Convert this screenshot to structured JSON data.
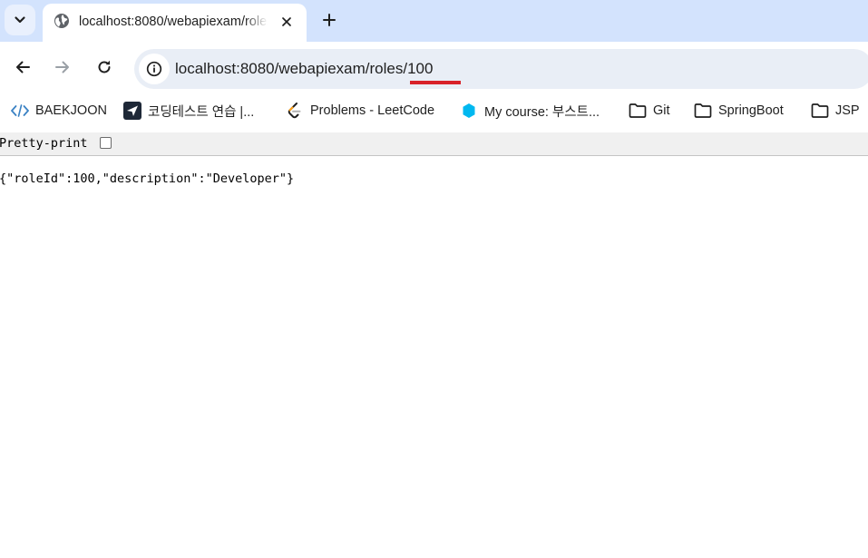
{
  "browser": {
    "tab": {
      "title": "localhost:8080/webapiexam/roles/100",
      "favicon": "globe-icon"
    },
    "nav": {
      "back": "arrow-left-icon",
      "forward": "arrow-right-icon",
      "reload": "reload-icon"
    },
    "address_bar": {
      "url": "localhost:8080/webapiexam/roles/100",
      "site_info_icon": "info-circle-icon",
      "highlight_color": "#d8222a"
    },
    "bookmarks": [
      {
        "label": "BAEKJOON",
        "icon": "code-bracket-icon"
      },
      {
        "label": "코딩테스트 연습 |...",
        "icon": "programmers-icon"
      },
      {
        "label": "Problems - LeetCode",
        "icon": "leetcode-icon"
      },
      {
        "label": "My course: 부스트...",
        "icon": "boostcourse-icon"
      },
      {
        "label": "Git",
        "icon": "folder-icon"
      },
      {
        "label": "SpringBoot",
        "icon": "folder-icon"
      },
      {
        "label": "JSP",
        "icon": "folder-icon"
      }
    ]
  },
  "page": {
    "pretty_print_label": "Pretty-print",
    "pretty_print_checked": false,
    "json_text": "{\"roleId\":100,\"description\":\"Developer\"}"
  },
  "colors": {
    "tabstrip": "#d3e3fd",
    "omnibox": "#e9eef6",
    "leetcode_orange": "#ffa116",
    "boost_blue": "#00b8f0"
  }
}
